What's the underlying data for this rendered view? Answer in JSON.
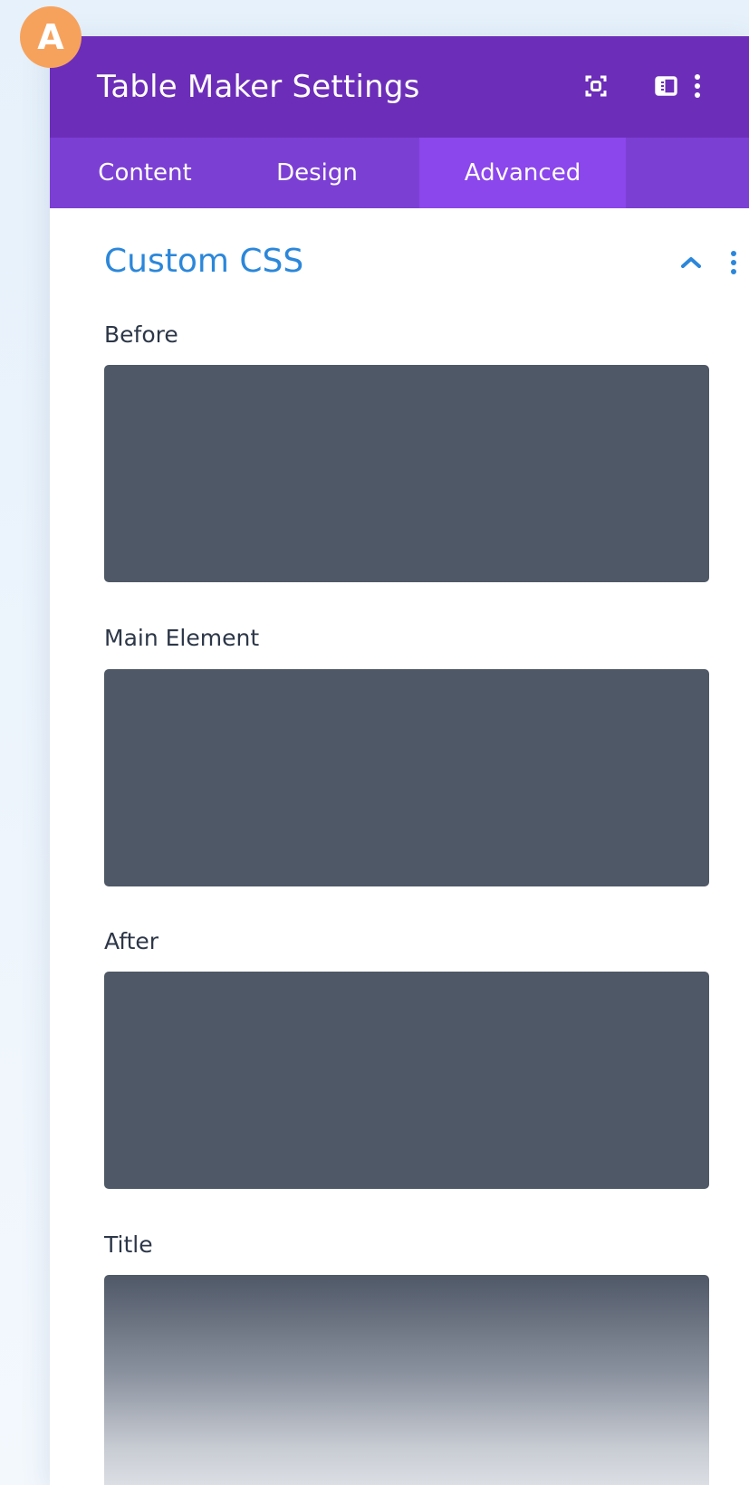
{
  "badge": {
    "letter": "A"
  },
  "header": {
    "title": "Table Maker Settings",
    "icons": [
      "focus-icon",
      "sidebar-toggle-icon",
      "more-vertical-icon"
    ]
  },
  "tabs": [
    {
      "label": "Content",
      "active": false
    },
    {
      "label": "Design",
      "active": false
    },
    {
      "label": "Advanced",
      "active": true
    }
  ],
  "section": {
    "title": "Custom CSS",
    "expanded": true,
    "fields": [
      {
        "label": "Before",
        "value": ""
      },
      {
        "label": "Main Element",
        "value": ""
      },
      {
        "label": "After",
        "value": ""
      },
      {
        "label": "Title",
        "value": ""
      }
    ]
  },
  "colors": {
    "header": "#6c2eb9",
    "tabs": "#7c3fd4",
    "active_tab": "#8b46ec",
    "section_title": "#2b87da",
    "field_bg": "#4f5867",
    "badge": "#f7a25c"
  }
}
